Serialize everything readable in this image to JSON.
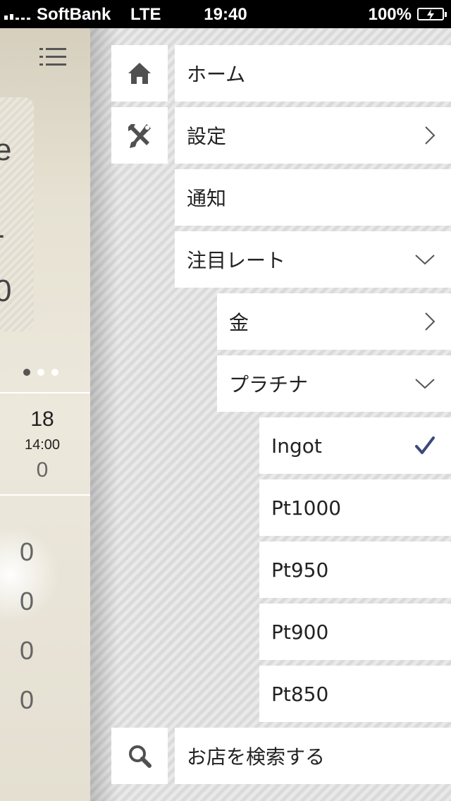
{
  "status_bar": {
    "carrier": "SoftBank",
    "network": "LTE",
    "time": "19:40",
    "battery": "100%"
  },
  "main": {
    "card_lines": [
      "e",
      "-",
      "0"
    ],
    "date_day": "18",
    "date_time": "14:00",
    "date_value": "0",
    "row_values": [
      "0",
      "0",
      "0",
      "0"
    ],
    "page_count": 3,
    "active_page": 1
  },
  "menu": {
    "home": {
      "label": "ホーム",
      "icon": "home-icon"
    },
    "settings": {
      "label": "設定",
      "icon": "wrench-screwdriver-icon",
      "accessory": "chevron-right-icon"
    },
    "notifications": {
      "label": "通知"
    },
    "watch_rates": {
      "label": "注目レート",
      "accessory": "chevron-down-icon",
      "gold": {
        "label": "金",
        "accessory": "chevron-right-icon"
      },
      "platinum": {
        "label": "プラチナ",
        "accessory": "chevron-down-icon",
        "options": [
          {
            "label": "Ingot",
            "selected": true
          },
          {
            "label": "Pt1000",
            "selected": false
          },
          {
            "label": "Pt950",
            "selected": false
          },
          {
            "label": "Pt900",
            "selected": false
          },
          {
            "label": "Pt850",
            "selected": false
          }
        ]
      }
    },
    "search_store": {
      "label": "お店を検索する",
      "icon": "search-icon"
    }
  },
  "colors": {
    "checkmark": "#3b4a7a",
    "icon": "#505050",
    "chevron": "#555555"
  }
}
